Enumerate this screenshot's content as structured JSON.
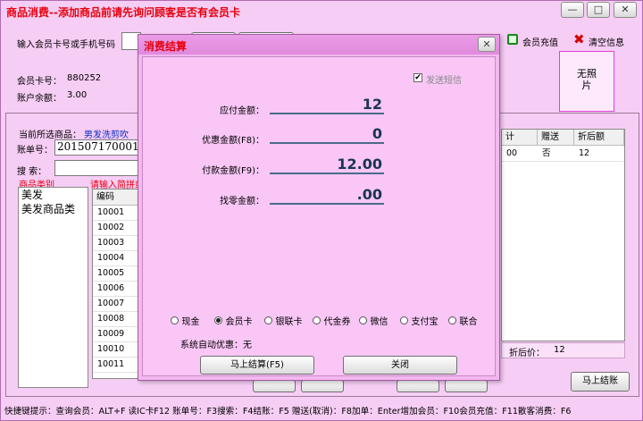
{
  "window": {
    "title": "商品消费--添加商品前请先询问顾客是否有会员卡",
    "buttons": {
      "minimize": "—",
      "maximize": "□",
      "close": "✕"
    }
  },
  "top": {
    "member_search_label": "输入会员卡号或手机号码",
    "member_search_value": "",
    "member_recharge": "会员充值",
    "clear_info": "清空信息",
    "card_no_label": "会员卡号：",
    "card_no_value": "880252",
    "balance_label": "账户余额：",
    "balance_value": "3.00",
    "photo_text": "无照片"
  },
  "left": {
    "current_item_label": "当前所选商品：",
    "current_item_value": "男发洗剪吹",
    "order_no_label": "账单号：",
    "order_no_value": "2015071700011",
    "search_label": "搜  索：",
    "category_header": "商品类别",
    "search_hint": "请输入简拼或",
    "categories": [
      "美发",
      "美发商品类"
    ],
    "code_header": "编码",
    "codes": [
      "10001",
      "10002",
      "10003",
      "10004",
      "10005",
      "10006",
      "10007",
      "10008",
      "10009",
      "10010",
      "10011"
    ]
  },
  "right": {
    "col_partial": "计",
    "col_gift": "赠送",
    "col_discount": "折后额",
    "row": {
      "partial": "00",
      "gift": "否",
      "discount": "12"
    },
    "after_discount_label": "折后价：",
    "after_discount_value": "12",
    "checkout_button": "马上结账"
  },
  "shortcuts": "快捷键提示：查询会员：ALT+F 读IC卡F12 账单号：F3搜索：F4结账：F5 赠送(取消)：F8加单：Enter增加会员：F10会员充值：F11散客消费：F6",
  "dialog": {
    "title": "消费结算",
    "close": "✕",
    "send_sms_label": "发送短信",
    "send_sms_checked": true,
    "payable_label": "应付金额：",
    "payable_value": "12",
    "discount_label": "优惠金额(F8)：",
    "discount_value": "0",
    "paid_label": "付款金额(F9)：",
    "paid_value": "12.00",
    "change_label": "找零金额：",
    "change_value": ".00",
    "payment_methods": [
      {
        "label": "现金",
        "selected": false
      },
      {
        "label": "会员卡",
        "selected": true
      },
      {
        "label": "银联卡",
        "selected": false
      },
      {
        "label": "代金券",
        "selected": false
      },
      {
        "label": "微信",
        "selected": false
      },
      {
        "label": "支付宝",
        "selected": false
      },
      {
        "label": "联合",
        "selected": false
      }
    ],
    "auto_discount": "系统自动优惠：无",
    "settle_button": "马上结算(F5)",
    "close_button": "关闭"
  }
}
